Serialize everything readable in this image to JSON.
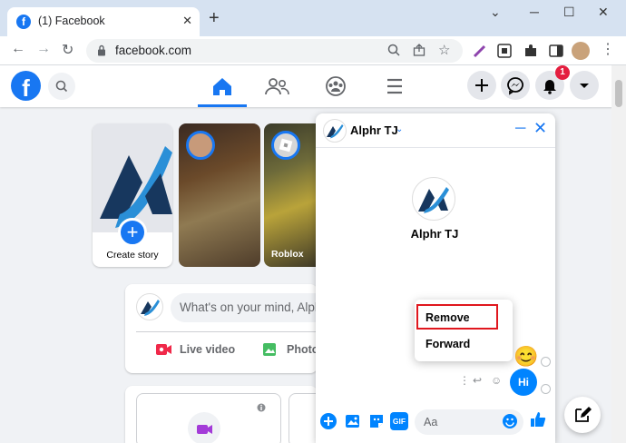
{
  "browser": {
    "tab_title": "(1) Facebook",
    "new_tab": "+",
    "url": "facebook.com",
    "window_controls": {
      "minimize": "─",
      "maximize": "☐",
      "close": "✕"
    }
  },
  "facebook": {
    "notification_count": "1",
    "stories": {
      "create_label": "Create story",
      "items": [
        {
          "label": ""
        },
        {
          "label": "Roblox"
        }
      ]
    },
    "composer": {
      "placeholder": "What's on your mind, Alph",
      "actions": [
        "Live video",
        "Photo"
      ]
    }
  },
  "chat": {
    "contact_name": "Alphr TJ",
    "profile_name": "Alphr TJ",
    "context_menu": [
      "Remove",
      "Forward"
    ],
    "messages": [
      {
        "type": "emoji",
        "text": "😊"
      },
      {
        "type": "text",
        "text": "Hi"
      }
    ],
    "input_placeholder": "Aa",
    "composer_tools": [
      "+",
      "photo",
      "sticker",
      "GIF"
    ],
    "gif_label": "GIF"
  },
  "colors": {
    "brand_blue": "#1877f2",
    "messenger_blue": "#0084ff",
    "highlight_red": "#e0171e"
  }
}
